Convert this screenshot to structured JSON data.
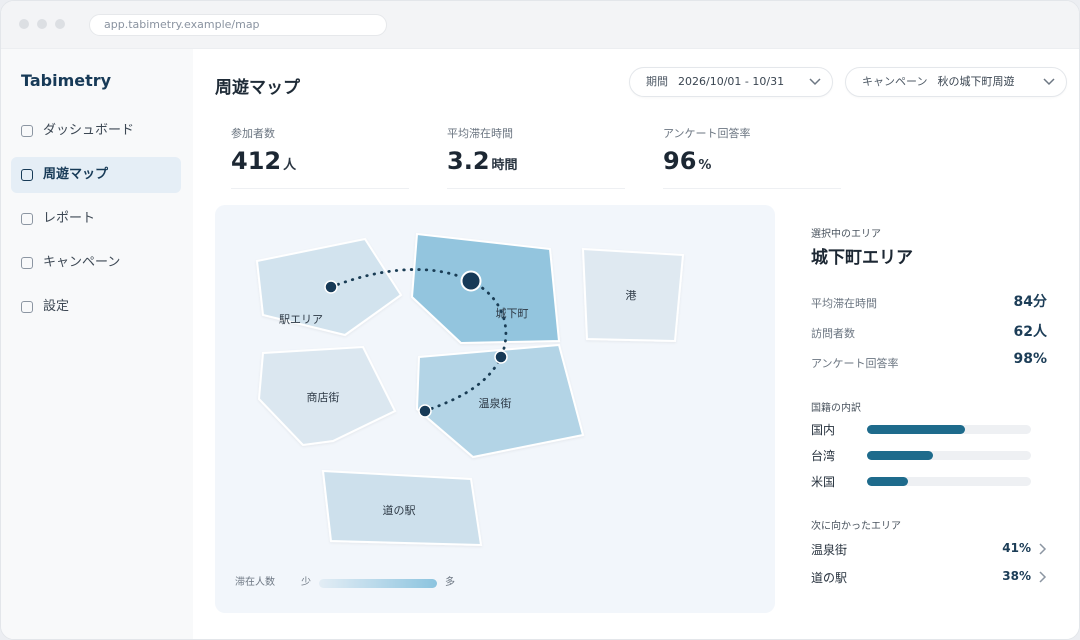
{
  "browser": {
    "url": "app.tabimetry.example/map"
  },
  "sidebar": {
    "brand": "Tabimetry",
    "items": [
      {
        "label": "ダッシュボード",
        "active": false
      },
      {
        "label": "周遊マップ",
        "active": true
      },
      {
        "label": "レポート",
        "active": false
      },
      {
        "label": "キャンペーン",
        "active": false
      },
      {
        "label": "設定",
        "active": false
      }
    ]
  },
  "header": {
    "title": "周遊マップ",
    "period": {
      "label": "期間",
      "value": "2026/10/01 - 10/31"
    },
    "campaign": {
      "label": "キャンペーン",
      "value": "秋の城下町周遊"
    }
  },
  "stats": [
    {
      "label": "参加者数",
      "value": "412",
      "unit": "人"
    },
    {
      "label": "平均滞在時間",
      "value": "3.2",
      "unit": "時間"
    },
    {
      "label": "アンケート回答率",
      "value": "96",
      "unit": "%"
    }
  ],
  "map": {
    "areas": [
      {
        "name": "駅エリア",
        "density": 0.25
      },
      {
        "name": "城下町",
        "density": 0.95,
        "selected": true
      },
      {
        "name": "港",
        "density": 0.1
      },
      {
        "name": "商店街",
        "density": 0.15
      },
      {
        "name": "温泉街",
        "density": 0.6
      },
      {
        "name": "道の駅",
        "density": 0.3
      }
    ],
    "legend": {
      "title": "滞在人数",
      "low": "少",
      "high": "多"
    }
  },
  "panel": {
    "heading": "選択中のエリア",
    "area_name": "城下町エリア",
    "metrics": [
      {
        "label": "平均滞在時間",
        "value": "84分"
      },
      {
        "label": "訪問者数",
        "value": "62人"
      },
      {
        "label": "アンケート回答率",
        "value": "98%"
      }
    ],
    "nationality_heading": "国籍の内訳",
    "nationalities": [
      {
        "label": "国内",
        "fraction": 0.6
      },
      {
        "label": "台湾",
        "fraction": 0.4
      },
      {
        "label": "米国",
        "fraction": 0.25
      }
    ],
    "next_heading": "次に向かったエリア",
    "next_areas": [
      {
        "label": "温泉街",
        "pct": "41%"
      },
      {
        "label": "道の駅",
        "pct": "38%"
      }
    ]
  },
  "colors": {
    "accent": "#1e6b8c",
    "brand": "#173a57",
    "route": "#1a3d55"
  },
  "icons": [
    "checkbox-icon",
    "chevron-down-icon",
    "chevron-right-icon"
  ]
}
